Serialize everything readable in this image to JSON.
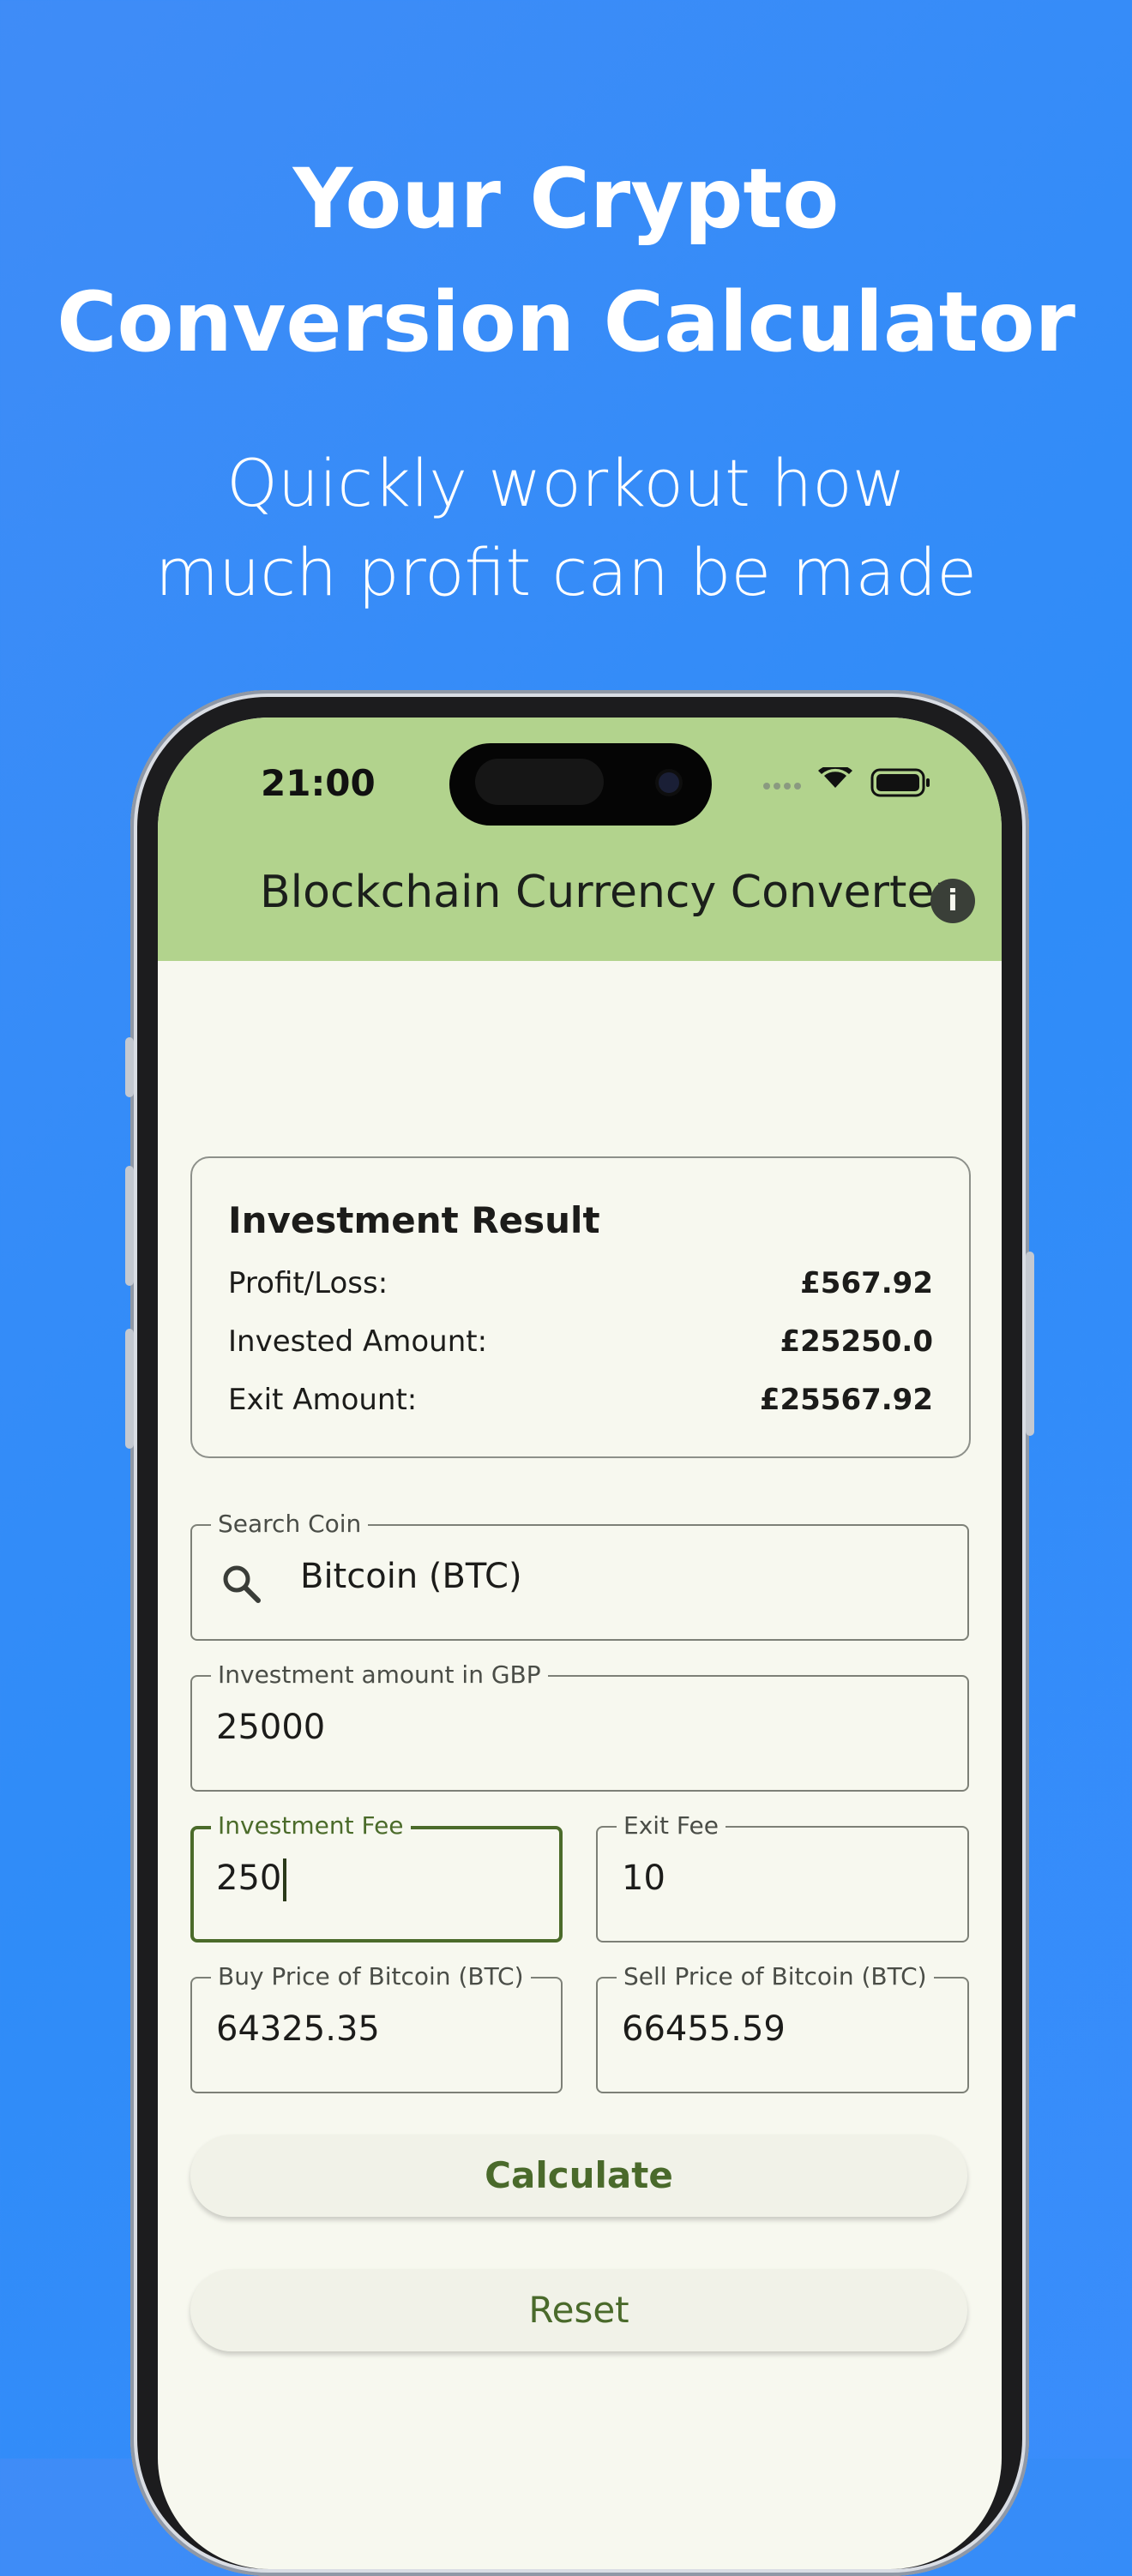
{
  "hero": {
    "title_line1": "Your Crypto",
    "title_line2": "Conversion Calculator",
    "subtitle_line1": "Quickly workout how",
    "subtitle_line2": "much profit can be made"
  },
  "status_bar": {
    "time": "21:00"
  },
  "app_bar": {
    "title": "Blockchain Currency Converter",
    "info_icon": "info-icon"
  },
  "result": {
    "title": "Investment Result",
    "rows": [
      {
        "label": "Profit/Loss:",
        "value": "£567.92"
      },
      {
        "label": "Invested Amount:",
        "value": "£25250.0"
      },
      {
        "label": "Exit Amount:",
        "value": "£25567.92"
      }
    ]
  },
  "form": {
    "search": {
      "label": "Search Coin",
      "value": "Bitcoin (BTC)",
      "icon": "search-icon"
    },
    "investment_amount": {
      "label": "Investment amount in GBP",
      "value": "25000"
    },
    "investment_fee": {
      "label": "Investment Fee",
      "value": "250"
    },
    "exit_fee": {
      "label": "Exit Fee",
      "value": "10"
    },
    "buy_price": {
      "label": "Buy Price of Bitcoin (BTC)",
      "value": "64325.35"
    },
    "sell_price": {
      "label": "Sell Price of Bitcoin (BTC)",
      "value": "66455.59"
    }
  },
  "buttons": {
    "calculate": "Calculate",
    "reset": "Reset"
  },
  "colors": {
    "background": "#3a8cf8",
    "app_bar": "#b2d38d",
    "screen": "#f7f8ef",
    "accent": "#4b6b2a"
  }
}
